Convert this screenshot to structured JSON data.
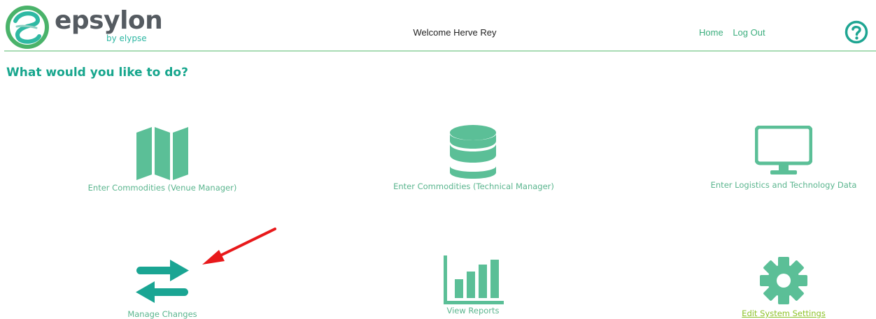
{
  "header": {
    "logo": {
      "word": "epsylon",
      "sub": "by elypse"
    },
    "welcome": "Welcome Herve Rey",
    "nav": {
      "home": "Home",
      "logout": "Log Out"
    },
    "help_icon": "question-circle-icon"
  },
  "main": {
    "prompt": "What would you like to do?",
    "tiles": [
      {
        "label": "Enter Commodities (Venue Manager)",
        "icon": "map-icon"
      },
      {
        "label": "Enter Commodities (Technical Manager)",
        "icon": "database-icon"
      },
      {
        "label": "Enter Logistics and Technology Data",
        "icon": "monitor-icon"
      },
      {
        "label": "Manage Changes",
        "icon": "exchange-arrows-icon"
      },
      {
        "label": "View Reports",
        "icon": "bar-chart-icon"
      },
      {
        "label": "Edit System Settings",
        "icon": "gear-icon"
      }
    ]
  },
  "colors": {
    "icon_light": "#5bbf97",
    "icon_teal": "#1aa593",
    "link_green": "#3cae7e",
    "link_lime": "#8dc229",
    "heading": "#17a68d",
    "annotation": "#e8191b"
  }
}
